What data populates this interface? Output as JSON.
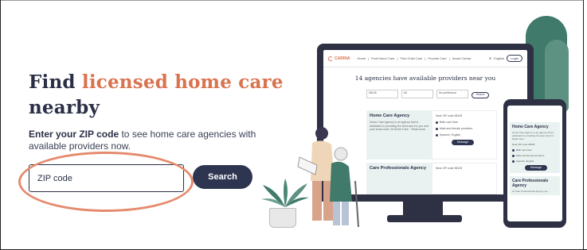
{
  "hero": {
    "title_line1_plain": "Find ",
    "title_line1_accent": "licensed home care",
    "title_line2": "nearby",
    "subtitle_bold": "Enter your ZIP code",
    "subtitle_rest": " to see home care agencies with available providers now."
  },
  "zip_form": {
    "placeholder": "ZIP code",
    "search_label": "Search"
  },
  "colors": {
    "accent": "#d9734f",
    "navy": "#2e3551",
    "highlight_ring": "#e58a6d"
  },
  "monitor": {
    "brand": "CARINA",
    "nav_items": [
      "Home",
      "Find Home Care",
      "Find Child Care",
      "Provide Care",
      "About Carina"
    ],
    "language": "English",
    "login": "Login",
    "title": "14 agencies have available providers near you",
    "filters": [
      "98105",
      "All",
      "No preference"
    ],
    "filter_search": "Search",
    "cards": [
      {
        "name": "Home Care Agency",
        "text": "Home Care Agency is an agency that is dedicated to providing the best care for you and your loved ones. At Home Care... Read more",
        "zip": "Near ZIP code 98105",
        "availability": "Bath care Now",
        "services": "Male and female providers",
        "languages": "Spanish, English",
        "message": "Message"
      },
      {
        "name": "Care Professionals Agency",
        "zip": "Near ZIP code 98105"
      }
    ]
  },
  "phone": {
    "cards": [
      {
        "name": "Home Care Agency",
        "text": "Home Care Agency is an agency that is dedicated to providing the best care for... Read more",
        "zip": "Near ZIP code 98105",
        "availability": "Bath care Now",
        "services": "Male and female providers",
        "languages": "Spanish, English",
        "message": "Message"
      },
      {
        "name": "Care Professionals Agency",
        "text": "At Care Professionals Agency we..."
      }
    ]
  }
}
